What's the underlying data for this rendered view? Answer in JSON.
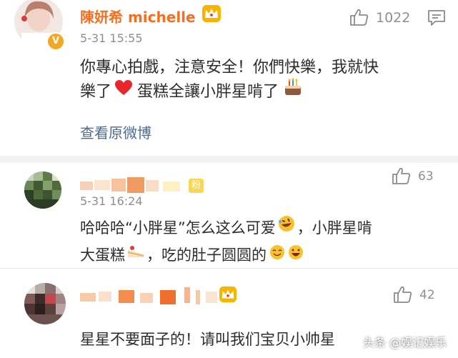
{
  "post": {
    "author": "陳妍希 michelle",
    "time": "5-31 15:55",
    "like_count": "1022",
    "text_line1": "你專心拍戲，注意安全！你們快樂，我就快",
    "text_line2a": "樂了",
    "text_line2b": "蛋糕全讓小胖星啃了",
    "view_original": "查看原微博"
  },
  "comments": [
    {
      "time": "5-31 16:24",
      "fan_badge": "粉",
      "like_count": "63",
      "line1a": "哈哈哈“小胖星”怎么这么可爱",
      "line1b": "，小胖星啃",
      "line2a": "大蛋糕",
      "line2b": "，吃的肚子圆圆的"
    },
    {
      "like_count": "42",
      "line1": "星星不要面子的！请叫我们宝贝小帅星"
    }
  ],
  "watermark": "头条 @娱记娱乐",
  "colors": {
    "name": "#f76e22",
    "link": "#4d6a94",
    "heart": "#e8262e",
    "gap": "#f2f2f2"
  },
  "icons": [
    "crown-icon",
    "v-verified-icon",
    "thumbs-up-icon",
    "comment-box-icon",
    "heart-icon",
    "cake-icon",
    "rofl-emoji-icon",
    "shortcake-icon",
    "smile-emoji-icon",
    "laugh-emoji-icon"
  ]
}
